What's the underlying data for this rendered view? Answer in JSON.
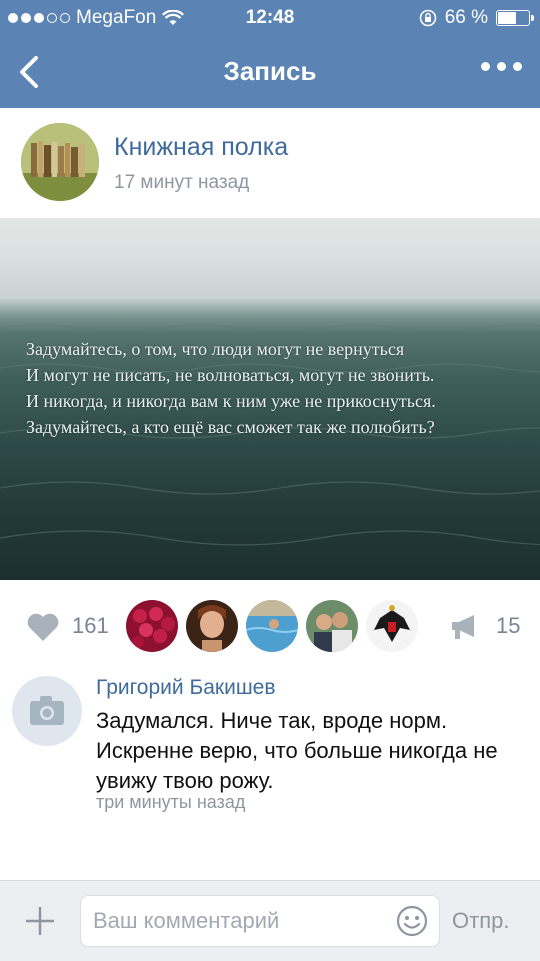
{
  "status_bar": {
    "carrier": "MegaFon",
    "time": "12:48",
    "battery_percent": "66 %",
    "battery_level": 0.66,
    "icons": [
      "signal-dots-icon",
      "wifi-icon",
      "rotation-lock-icon",
      "battery-icon"
    ]
  },
  "nav": {
    "title": "Запись",
    "back_icon": "chevron-left-icon",
    "more_icon": "more-dots-icon"
  },
  "post": {
    "group_name": "Книжная полка",
    "time_ago": "17 минут назад",
    "image_text": [
      "Задумайтесь, о том, что люди могут не вернуться",
      "И могут не писать, не волноваться, могут не звонить.",
      "И никогда, и никогда вам к ним уже не прикоснуться.",
      "Задумайтесь, а кто ещё вас сможет так же полюбить?"
    ],
    "likes": "161",
    "shares": "15",
    "liker_avatars": [
      "roses-avatar",
      "girl-avatar",
      "pool-avatar",
      "friends-avatar",
      "coat-of-arms-avatar"
    ]
  },
  "comment": {
    "author": "Григорий Бакишев",
    "text": "Задумался. Ниче так, вроде норм. Искренне верю, что больше никогда не увижу твою рожу.",
    "time": "три минуты назад"
  },
  "composer": {
    "placeholder": "Ваш комментарий",
    "send_label": "Отпр."
  },
  "colors": {
    "header": "#5b83b3",
    "link": "#3f6b9c",
    "muted": "#8f969f"
  }
}
